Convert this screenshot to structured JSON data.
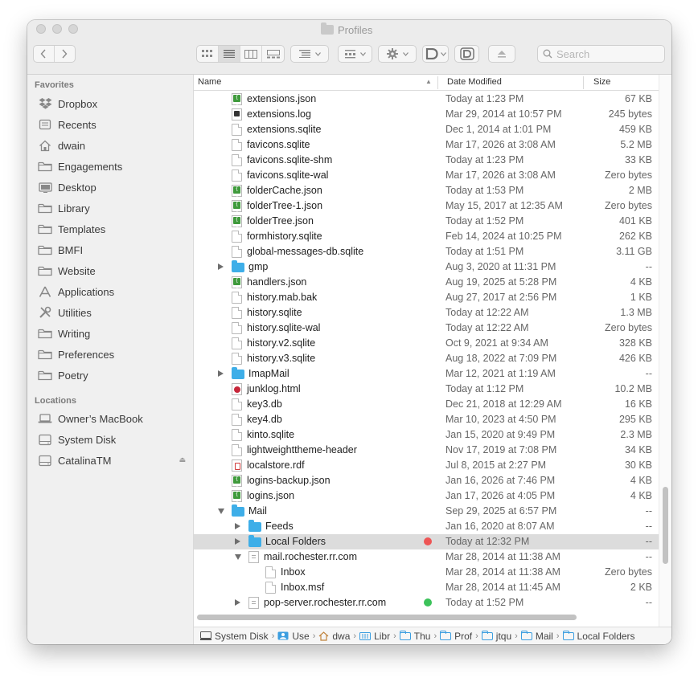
{
  "window": {
    "title": "Profiles"
  },
  "toolbar": {
    "search_placeholder": "Search",
    "icons": [
      "back-arrow",
      "forward-arrow",
      "icon-view",
      "list-view",
      "column-view",
      "gallery-view",
      "group-menu",
      "arrange-menu",
      "action-gear",
      "share-d",
      "d-button",
      "eject"
    ]
  },
  "sidebar": {
    "favorites_heading": "Favorites",
    "favorites": [
      {
        "label": "Dropbox",
        "icon": "dropbox-icon"
      },
      {
        "label": "Recents",
        "icon": "recents-icon"
      },
      {
        "label": "dwain",
        "icon": "home-icon"
      },
      {
        "label": "Engagements",
        "icon": "folder-icon"
      },
      {
        "label": "Desktop",
        "icon": "desktop-icon"
      },
      {
        "label": "Library",
        "icon": "folder-icon"
      },
      {
        "label": "Templates",
        "icon": "folder-icon"
      },
      {
        "label": "BMFI",
        "icon": "folder-icon"
      },
      {
        "label": "Website",
        "icon": "folder-icon"
      },
      {
        "label": "Applications",
        "icon": "applications-icon"
      },
      {
        "label": "Utilities",
        "icon": "utilities-icon"
      },
      {
        "label": "Writing",
        "icon": "folder-icon"
      },
      {
        "label": "Preferences",
        "icon": "folder-icon"
      },
      {
        "label": "Poetry",
        "icon": "folder-icon"
      }
    ],
    "locations_heading": "Locations",
    "locations": [
      {
        "label": "Owner’s MacBook",
        "icon": "laptop-icon"
      },
      {
        "label": "System Disk",
        "icon": "disk-icon"
      },
      {
        "label": "CatalinaTM",
        "icon": "disk-icon"
      }
    ]
  },
  "columns": {
    "name": "Name",
    "date": "Date Modified",
    "size": "Size"
  },
  "rows": [
    {
      "name": "extensions.json",
      "date": "Today at 1:23 PM",
      "size": "67 KB",
      "type": "json",
      "level": 0
    },
    {
      "name": "extensions.log",
      "date": "Mar 29, 2014 at 10:57 PM",
      "size": "245 bytes",
      "type": "log",
      "level": 0
    },
    {
      "name": "extensions.sqlite",
      "date": "Dec 1, 2014 at 1:01 PM",
      "size": "459 KB",
      "type": "doc",
      "level": 0
    },
    {
      "name": "favicons.sqlite",
      "date": "Mar 17, 2026 at 3:08 AM",
      "size": "5.2 MB",
      "type": "doc",
      "level": 0
    },
    {
      "name": "favicons.sqlite-shm",
      "date": "Today at 1:23 PM",
      "size": "33 KB",
      "type": "doc",
      "level": 0
    },
    {
      "name": "favicons.sqlite-wal",
      "date": "Mar 17, 2026 at 3:08 AM",
      "size": "Zero bytes",
      "type": "doc",
      "level": 0
    },
    {
      "name": "folderCache.json",
      "date": "Today at 1:53 PM",
      "size": "2 MB",
      "type": "json",
      "level": 0
    },
    {
      "name": "folderTree-1.json",
      "date": "May 15, 2017 at 12:35 AM",
      "size": "Zero bytes",
      "type": "json",
      "level": 0
    },
    {
      "name": "folderTree.json",
      "date": "Today at 1:52 PM",
      "size": "401 KB",
      "type": "json",
      "level": 0
    },
    {
      "name": "formhistory.sqlite",
      "date": "Feb 14, 2024 at 10:25 PM",
      "size": "262 KB",
      "type": "doc",
      "level": 0
    },
    {
      "name": "global-messages-db.sqlite",
      "date": "Today at 1:51 PM",
      "size": "3.11 GB",
      "type": "doc",
      "level": 0
    },
    {
      "name": "gmp",
      "date": "Aug 3, 2020 at 11:31 PM",
      "size": "--",
      "type": "folder",
      "level": 0,
      "disclosure": "closed"
    },
    {
      "name": "handlers.json",
      "date": "Aug 19, 2025 at 5:28 PM",
      "size": "4 KB",
      "type": "json",
      "level": 0
    },
    {
      "name": "history.mab.bak",
      "date": "Aug 27, 2017 at 2:56 PM",
      "size": "1 KB",
      "type": "doc",
      "level": 0
    },
    {
      "name": "history.sqlite",
      "date": "Today at 12:22 AM",
      "size": "1.3 MB",
      "type": "doc",
      "level": 0
    },
    {
      "name": "history.sqlite-wal",
      "date": "Today at 12:22 AM",
      "size": "Zero bytes",
      "type": "doc",
      "level": 0
    },
    {
      "name": "history.v2.sqlite",
      "date": "Oct 9, 2021 at 9:34 AM",
      "size": "328 KB",
      "type": "doc",
      "level": 0
    },
    {
      "name": "history.v3.sqlite",
      "date": "Aug 18, 2022 at 7:09 PM",
      "size": "426 KB",
      "type": "doc",
      "level": 0
    },
    {
      "name": "ImapMail",
      "date": "Mar 12, 2021 at 1:19 AM",
      "size": "--",
      "type": "folder",
      "level": 0,
      "disclosure": "closed"
    },
    {
      "name": "junklog.html",
      "date": "Today at 1:12 PM",
      "size": "10.2 MB",
      "type": "html",
      "level": 0
    },
    {
      "name": "key3.db",
      "date": "Dec 21, 2018 at 12:29 AM",
      "size": "16 KB",
      "type": "doc",
      "level": 0
    },
    {
      "name": "key4.db",
      "date": "Mar 10, 2023 at 4:50 PM",
      "size": "295 KB",
      "type": "doc",
      "level": 0
    },
    {
      "name": "kinto.sqlite",
      "date": "Jan 15, 2020 at 9:49 PM",
      "size": "2.3 MB",
      "type": "doc",
      "level": 0
    },
    {
      "name": "lightweighttheme-header",
      "date": "Nov 17, 2019 at 7:08 PM",
      "size": "34 KB",
      "type": "doc",
      "level": 0
    },
    {
      "name": "localstore.rdf",
      "date": "Jul 8, 2015 at 2:27 PM",
      "size": "30 KB",
      "type": "rdf",
      "level": 0
    },
    {
      "name": "logins-backup.json",
      "date": "Jan 16, 2026 at 7:46 PM",
      "size": "4 KB",
      "type": "json",
      "level": 0
    },
    {
      "name": "logins.json",
      "date": "Jan 17, 2026 at 4:05 PM",
      "size": "4 KB",
      "type": "json",
      "level": 0
    },
    {
      "name": "Mail",
      "date": "Sep 29, 2025 at 6:57 PM",
      "size": "--",
      "type": "folder",
      "level": 0,
      "disclosure": "open"
    },
    {
      "name": "Feeds",
      "date": "Jan 16, 2020 at 8:07 AM",
      "size": "--",
      "type": "folder",
      "level": 1,
      "disclosure": "closed"
    },
    {
      "name": "Local Folders",
      "date": "Today at 12:32 PM",
      "size": "--",
      "type": "folder",
      "level": 1,
      "disclosure": "closed",
      "selected": true,
      "tag": "#ee5555"
    },
    {
      "name": "mail.rochester.rr.com",
      "date": "Mar 28, 2014 at 11:38 AM",
      "size": "--",
      "type": "mailfile",
      "level": 1,
      "disclosure": "open"
    },
    {
      "name": "Inbox",
      "date": "Mar 28, 2014 at 11:38 AM",
      "size": "Zero bytes",
      "type": "doc",
      "level": 2
    },
    {
      "name": "Inbox.msf",
      "date": "Mar 28, 2014 at 11:45 AM",
      "size": "2 KB",
      "type": "doc",
      "level": 2
    },
    {
      "name": "pop-server.rochester.rr.com",
      "date": "Today at 1:52 PM",
      "size": "--",
      "type": "mailfile",
      "level": 1,
      "disclosure": "closed",
      "tag": "#3cc25a"
    }
  ],
  "pathbar": [
    {
      "label": "System Disk",
      "icon": "disk"
    },
    {
      "label": "Use",
      "icon": "users"
    },
    {
      "label": "dwa",
      "icon": "home"
    },
    {
      "label": "Libr",
      "icon": "library"
    },
    {
      "label": "Thu",
      "icon": "folder"
    },
    {
      "label": "Prof",
      "icon": "folder"
    },
    {
      "label": "jtqu",
      "icon": "folder"
    },
    {
      "label": "Mail",
      "icon": "folder"
    },
    {
      "label": "Local Folders",
      "icon": "folder"
    }
  ]
}
